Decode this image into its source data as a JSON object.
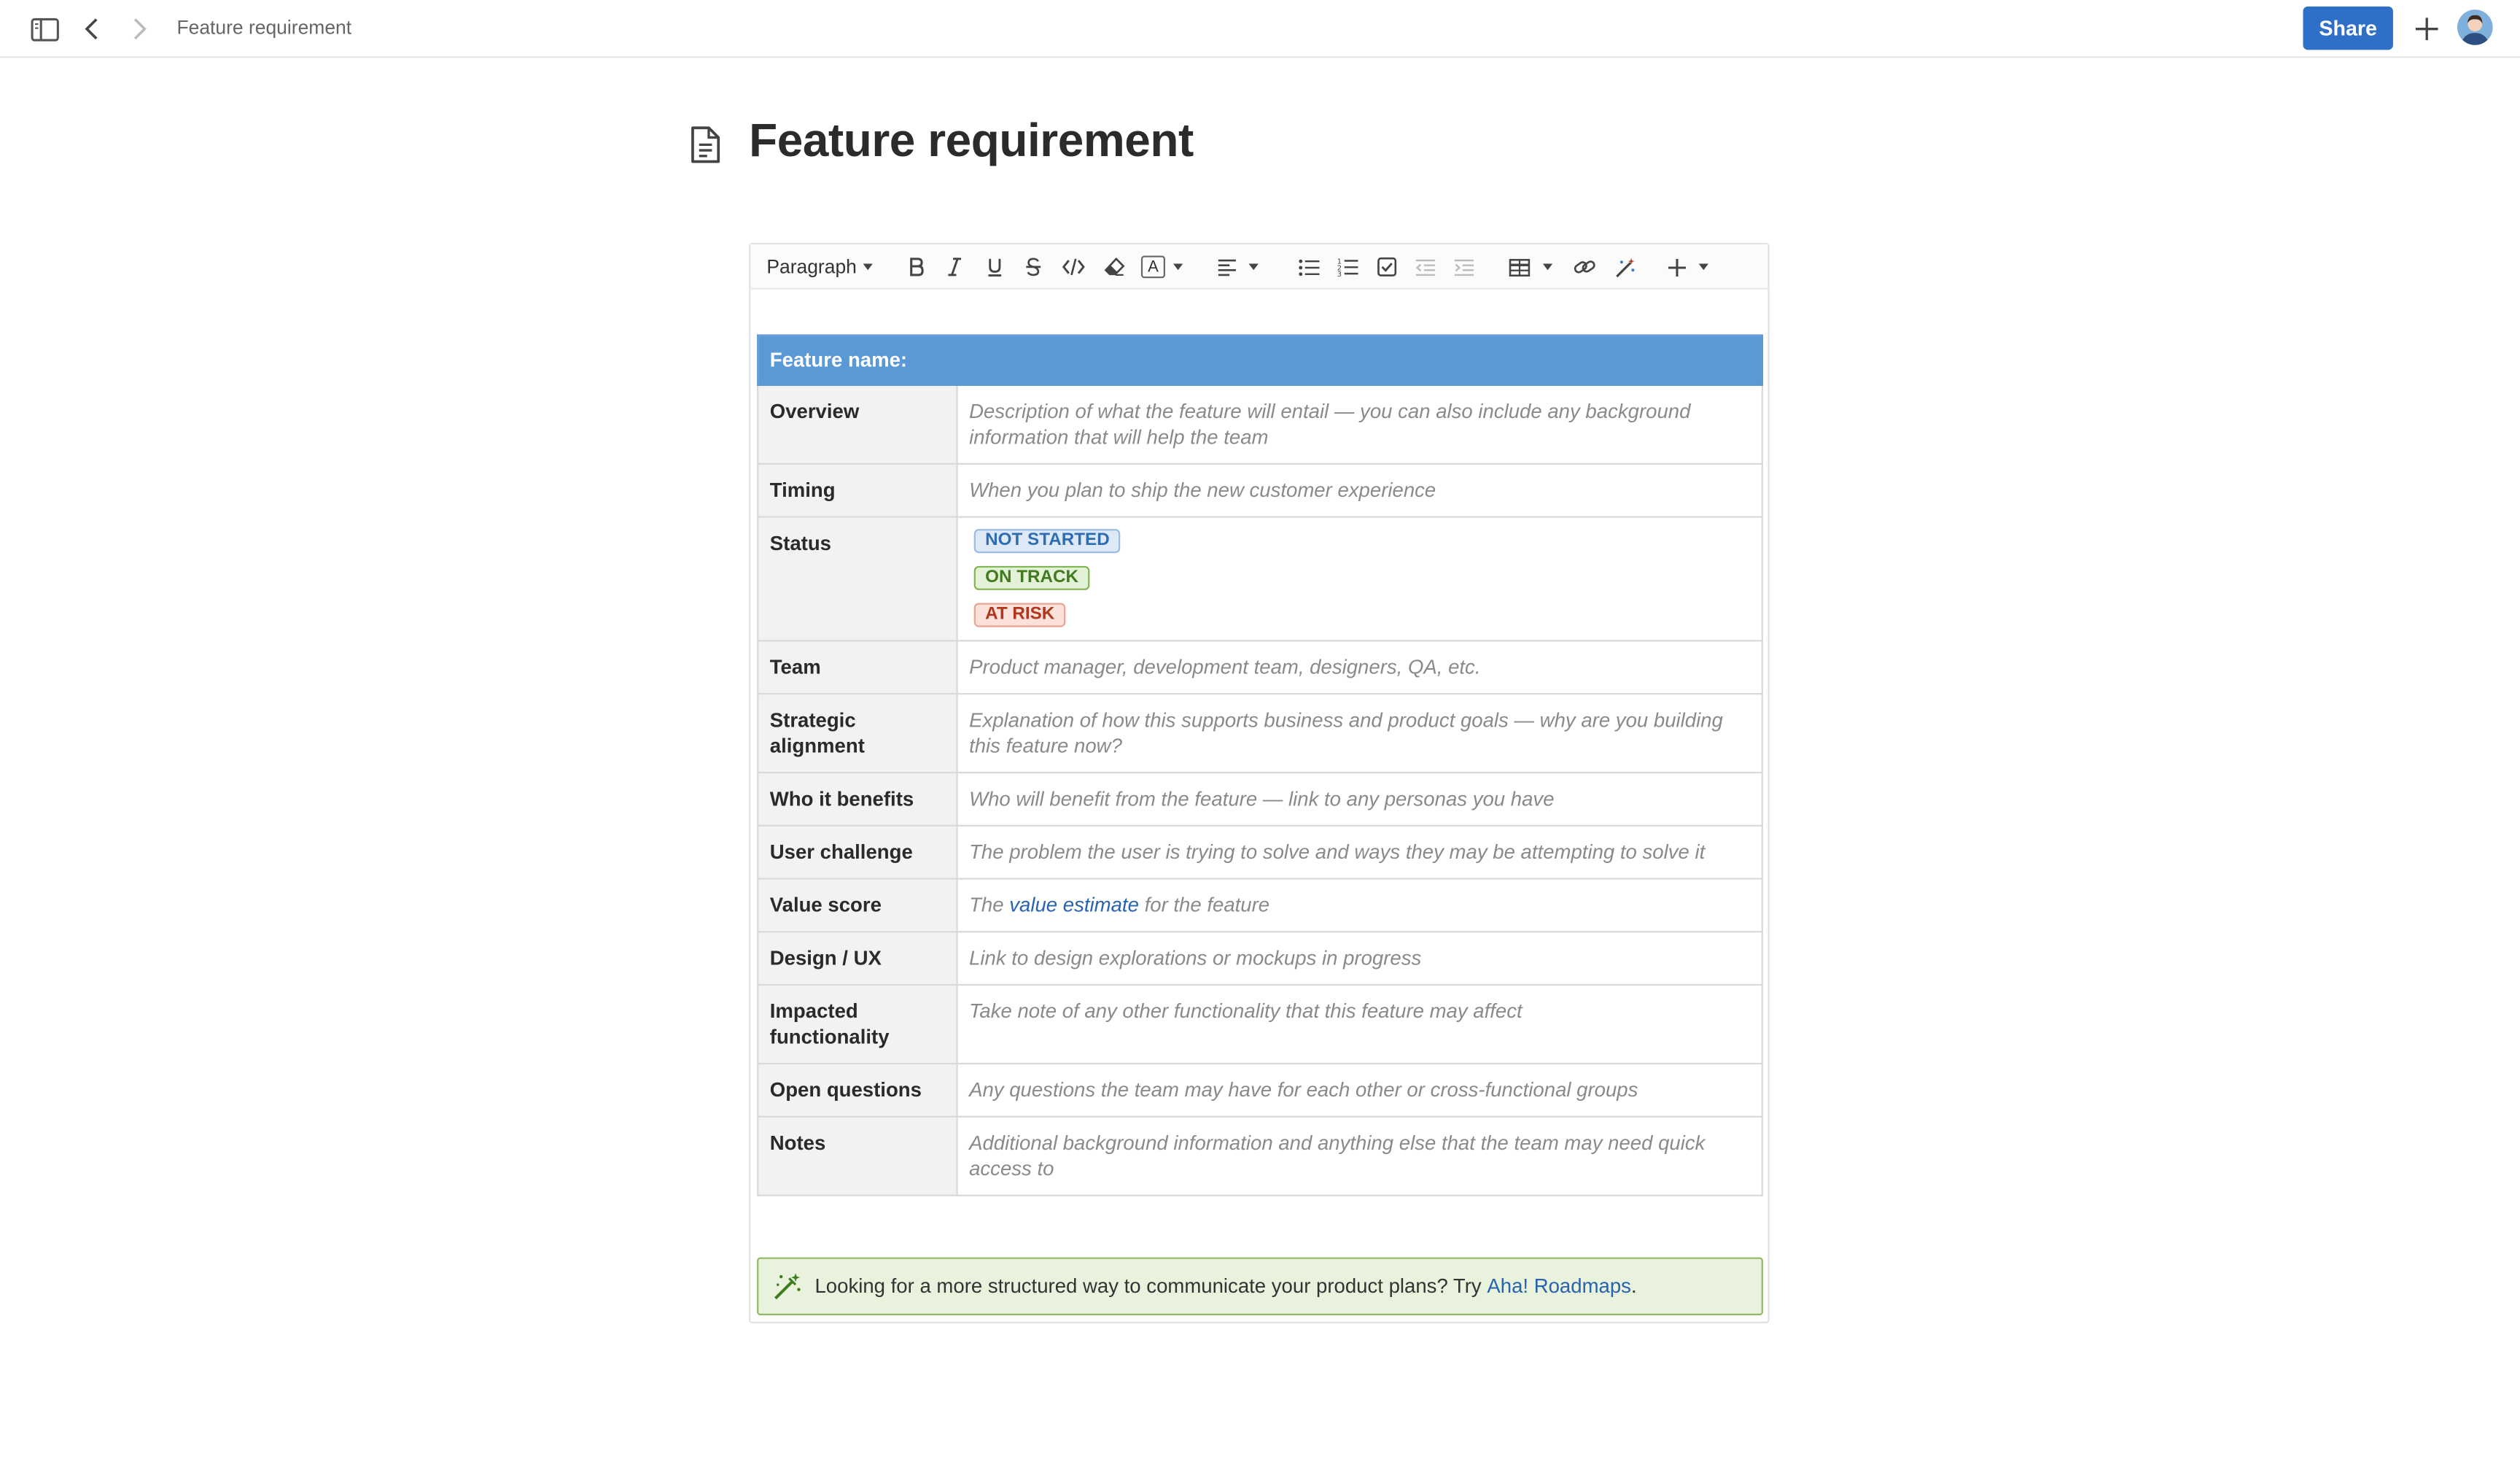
{
  "topbar": {
    "breadcrumb": "Feature requirement",
    "share_label": "Share"
  },
  "page": {
    "title": "Feature requirement"
  },
  "toolbar": {
    "paragraph_label": "Paragraph",
    "text_color_label": "A"
  },
  "table": {
    "header": "Feature name:",
    "rows": [
      {
        "label": "Overview",
        "value": "Description of what the feature will entail — you can also include any background information that will help the team"
      },
      {
        "label": "Timing",
        "value": "When you plan to ship the new customer experience"
      },
      {
        "label": "Status"
      },
      {
        "label": "Team",
        "value": "Product manager, development team, designers, QA, etc."
      },
      {
        "label": "Strategic alignment",
        "value": "Explanation of how this supports business and product goals — why are you building this feature now?"
      },
      {
        "label": "Who it benefits",
        "value": "Who will benefit from the feature — link to any personas you have"
      },
      {
        "label": "User challenge",
        "value": "The problem the user is trying to solve and ways they may be attempting to solve it"
      },
      {
        "label": "Value score",
        "value_before": "The",
        "link": "value estimate",
        "value_after": "for the feature"
      },
      {
        "label": "Design / UX",
        "value": "Link to design explorations or mockups in progress"
      },
      {
        "label": "Impacted functionality",
        "value": "Take note of any other functionality that this feature may affect"
      },
      {
        "label": "Open questions",
        "value": "Any questions the team may have for each other or cross-functional groups"
      },
      {
        "label": "Notes",
        "value": "Additional background information and anything else that the team may need quick access to"
      }
    ],
    "statuses": [
      {
        "label": "NOT STARTED",
        "color": "#2f6db3",
        "bg": "#dde9f7",
        "border": "#9cbde3"
      },
      {
        "label": "ON TRACK",
        "color": "#3f7a1e",
        "bg": "#e3f1d6",
        "border": "#7fb552"
      },
      {
        "label": "AT RISK",
        "color": "#b2361c",
        "bg": "#fbe1da",
        "border": "#eaa493"
      }
    ]
  },
  "callout": {
    "text": "Looking for a more structured way to communicate your product plans? Try",
    "link": "Aha! Roadmaps",
    "suffix": "."
  },
  "colors": {
    "accent": "#2e6fc7",
    "table_header": "#5b98d6",
    "callout_bg": "#e8f2dc"
  }
}
